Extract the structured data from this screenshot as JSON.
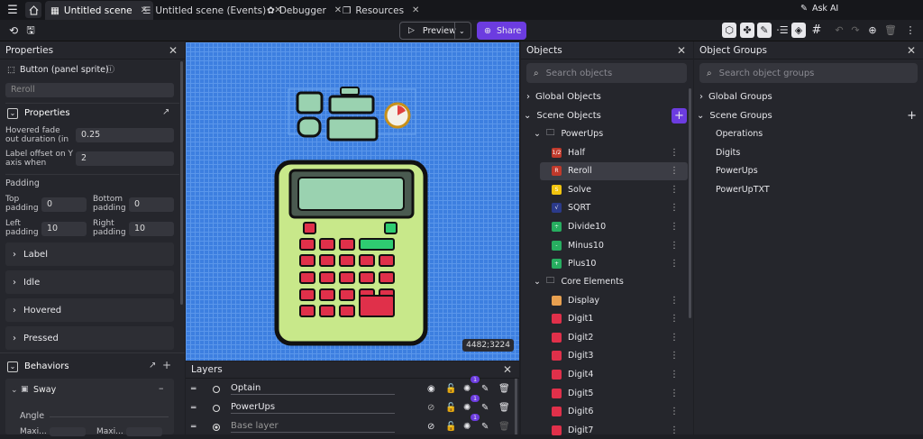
{
  "tabs": [
    {
      "label": "Untitled scene",
      "active": true
    },
    {
      "label": "Untitled scene (Events)",
      "active": false
    },
    {
      "label": "Debugger",
      "active": false
    },
    {
      "label": "Resources",
      "active": false
    }
  ],
  "top": {
    "ask_ai": "Ask AI",
    "preview": "Preview",
    "share": "Share"
  },
  "properties": {
    "title": "Properties",
    "object_type": "Button (panel sprite)",
    "object_name": "Reroll",
    "section": "Properties",
    "fade_label": "Hovered fade out duration (in",
    "fade_value": "0.25",
    "offset_label": "Label offset on Y axis when",
    "offset_value": "2",
    "padding": "Padding",
    "top_padding": "Top padding",
    "top_padding_value": "0",
    "bottom_padding": "Bottom padding",
    "bottom_padding_value": "0",
    "left_padding": "Left padding",
    "left_padding_value": "10",
    "right_padding": "Right padding",
    "right_padding_value": "10",
    "acc_label": "Label",
    "acc_idle": "Idle",
    "acc_hovered": "Hovered",
    "acc_pressed": "Pressed",
    "behaviors": "Behaviors",
    "sway": "Sway",
    "angle": "Angle",
    "maxi1": "Maxi...",
    "maxi2": "Maxi..."
  },
  "canvas": {
    "coords": "4482;3224"
  },
  "layers": {
    "title": "Layers",
    "items": [
      {
        "name": "Optain",
        "badge": "1"
      },
      {
        "name": "PowerUps",
        "badge": "1"
      },
      {
        "name": "Base layer",
        "badge": "1"
      }
    ]
  },
  "objects": {
    "title": "Objects",
    "search_placeholder": "Search objects",
    "global": "Global Objects",
    "scene": "Scene Objects",
    "folder1": "PowerUps",
    "folder2": "Core Elements",
    "items1": [
      {
        "name": "Half",
        "color": "#c0392b",
        "glyph": "1/2"
      },
      {
        "name": "Reroll",
        "color": "#c0392b",
        "glyph": "R"
      },
      {
        "name": "Solve",
        "color": "#f1c40f",
        "glyph": "S"
      },
      {
        "name": "SQRT",
        "color": "#2b3a8a",
        "glyph": "√"
      },
      {
        "name": "Divide10",
        "color": "#27ae60",
        "glyph": "÷"
      },
      {
        "name": "Minus10",
        "color": "#27ae60",
        "glyph": "-"
      },
      {
        "name": "Plus10",
        "color": "#27ae60",
        "glyph": "+"
      }
    ],
    "items2": [
      {
        "name": "Display",
        "color": "#e8a050"
      },
      {
        "name": "Digit1",
        "color": "#e0304a"
      },
      {
        "name": "Digit2",
        "color": "#e0304a"
      },
      {
        "name": "Digit3",
        "color": "#e0304a"
      },
      {
        "name": "Digit4",
        "color": "#e0304a"
      },
      {
        "name": "Digit5",
        "color": "#e0304a"
      },
      {
        "name": "Digit6",
        "color": "#e0304a"
      },
      {
        "name": "Digit7",
        "color": "#e0304a"
      }
    ]
  },
  "groups": {
    "title": "Object Groups",
    "search_placeholder": "Search object groups",
    "global": "Global Groups",
    "scene": "Scene Groups",
    "items": [
      "Operations",
      "Digits",
      "PowerUps",
      "PowerUpTXT"
    ]
  },
  "colors": {
    "accent": "#6c3ce0",
    "canvas_bg": "#3d7fe0",
    "calc_body": "#c8e88a"
  }
}
